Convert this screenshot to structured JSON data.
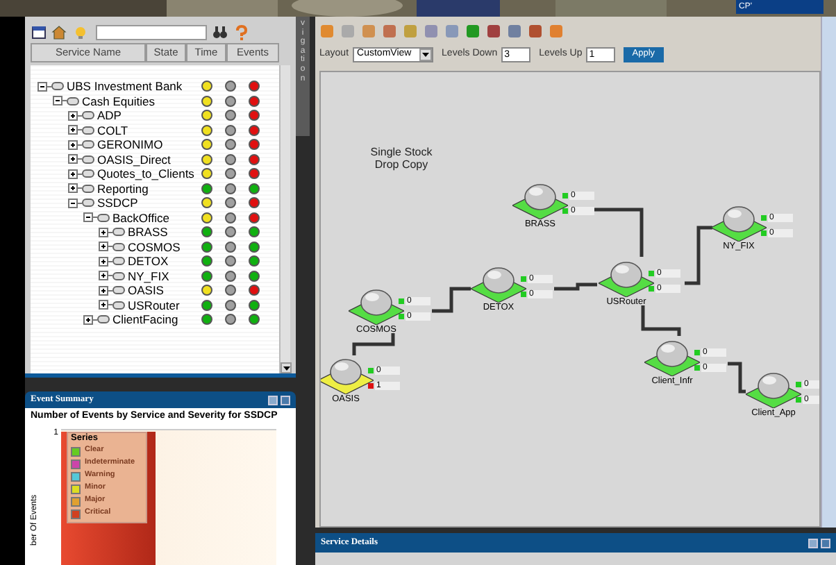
{
  "backdrop": {
    "tab_text": "CP'"
  },
  "service_tree": {
    "columns": [
      "Service Name",
      "State",
      "Time",
      "Events"
    ],
    "nodes": [
      {
        "name": "UBS Investment Bank",
        "expanded": true,
        "indicators": [
          {
            "color": "#f0e020"
          },
          {
            "color": "#a0a0a0"
          },
          {
            "color": "#e01010"
          }
        ],
        "children": [
          {
            "name": "Cash Equities",
            "expanded": true,
            "indicators": [
              {
                "color": "#f0e020"
              },
              {
                "color": "#a0a0a0"
              },
              {
                "color": "#e01010"
              }
            ],
            "children": [
              {
                "name": "ADP",
                "expanded": false,
                "indicators": [
                  {
                    "color": "#f0e020"
                  },
                  {
                    "color": "#a0a0a0"
                  },
                  {
                    "color": "#e01010"
                  }
                ]
              },
              {
                "name": "COLT",
                "expanded": false,
                "indicators": [
                  {
                    "color": "#f0e020"
                  },
                  {
                    "color": "#a0a0a0"
                  },
                  {
                    "color": "#e01010"
                  }
                ]
              },
              {
                "name": "GERONIMO",
                "expanded": false,
                "indicators": [
                  {
                    "color": "#f0e020"
                  },
                  {
                    "color": "#a0a0a0"
                  },
                  {
                    "color": "#e01010"
                  }
                ]
              },
              {
                "name": "OASIS_Direct",
                "expanded": false,
                "indicators": [
                  {
                    "color": "#f0e020"
                  },
                  {
                    "color": "#a0a0a0"
                  },
                  {
                    "color": "#e01010"
                  }
                ]
              },
              {
                "name": "Quotes_to_Clients",
                "expanded": false,
                "indicators": [
                  {
                    "color": "#f0e020"
                  },
                  {
                    "color": "#a0a0a0"
                  },
                  {
                    "color": "#e01010"
                  }
                ]
              },
              {
                "name": "Reporting",
                "expanded": false,
                "indicators": [
                  {
                    "color": "#10b010"
                  },
                  {
                    "color": "#a0a0a0"
                  },
                  {
                    "color": "#10b010"
                  }
                ]
              },
              {
                "name": "SSDCP",
                "expanded": true,
                "indicators": [
                  {
                    "color": "#f0e020"
                  },
                  {
                    "color": "#a0a0a0"
                  },
                  {
                    "color": "#e01010"
                  }
                ],
                "children": [
                  {
                    "name": "BackOffice",
                    "expanded": true,
                    "indicators": [
                      {
                        "color": "#f0e020"
                      },
                      {
                        "color": "#a0a0a0"
                      },
                      {
                        "color": "#e01010"
                      }
                    ],
                    "children": [
                      {
                        "name": "BRASS",
                        "expanded": false,
                        "indicators": [
                          {
                            "color": "#10b010"
                          },
                          {
                            "color": "#a0a0a0"
                          },
                          {
                            "color": "#10b010"
                          }
                        ]
                      },
                      {
                        "name": "COSMOS",
                        "expanded": false,
                        "indicators": [
                          {
                            "color": "#10b010"
                          },
                          {
                            "color": "#a0a0a0"
                          },
                          {
                            "color": "#10b010"
                          }
                        ]
                      },
                      {
                        "name": "DETOX",
                        "expanded": false,
                        "indicators": [
                          {
                            "color": "#10b010"
                          },
                          {
                            "color": "#a0a0a0"
                          },
                          {
                            "color": "#10b010"
                          }
                        ]
                      },
                      {
                        "name": "NY_FIX",
                        "expanded": false,
                        "indicators": [
                          {
                            "color": "#10b010"
                          },
                          {
                            "color": "#a0a0a0"
                          },
                          {
                            "color": "#10b010"
                          }
                        ]
                      },
                      {
                        "name": "OASIS",
                        "expanded": false,
                        "indicators": [
                          {
                            "color": "#f0e020"
                          },
                          {
                            "color": "#a0a0a0"
                          },
                          {
                            "color": "#e01010"
                          }
                        ]
                      },
                      {
                        "name": "USRouter",
                        "expanded": false,
                        "indicators": [
                          {
                            "color": "#10b010"
                          },
                          {
                            "color": "#a0a0a0"
                          },
                          {
                            "color": "#10b010"
                          }
                        ]
                      }
                    ]
                  },
                  {
                    "name": "ClientFacing",
                    "expanded": false,
                    "indicators": [
                      {
                        "color": "#10b010"
                      },
                      {
                        "color": "#a0a0a0"
                      },
                      {
                        "color": "#10b010"
                      }
                    ]
                  }
                ]
              }
            ]
          }
        ]
      }
    ]
  },
  "navigation_tab": {
    "label": "vigation"
  },
  "event_summary": {
    "title": "Event Summary",
    "chart_title": "Number of Events by Service and Severity for SSDCP",
    "tick": "1",
    "ylabel": "ber Of Events",
    "legend_title": "Series",
    "legend": [
      {
        "label": "Clear",
        "color": "#66cc22"
      },
      {
        "label": "Indeterminate",
        "color": "#cc44aa"
      },
      {
        "label": "Warning",
        "color": "#55c8d8"
      },
      {
        "label": "Minor",
        "color": "#dddd22"
      },
      {
        "label": "Major",
        "color": "#e0a030"
      },
      {
        "label": "Critical",
        "color": "#d04020"
      }
    ]
  },
  "view": {
    "layout_label": "Layout",
    "layout_value": "CustomView",
    "levels_down_label": "Levels Down",
    "levels_down": "3",
    "levels_up_label": "Levels Up",
    "levels_up": "1",
    "apply": "Apply",
    "caption": "Single Stock Drop Copy",
    "nodes": [
      {
        "name": "BRASS",
        "color": "#55dd44",
        "counters": [
          {
            "value": "0",
            "color": "#22cc22"
          },
          {
            "value": "0",
            "color": "#22cc22"
          }
        ]
      },
      {
        "name": "NY_FIX",
        "color": "#55dd44",
        "counters": [
          {
            "value": "0",
            "color": "#22cc22"
          },
          {
            "value": "0",
            "color": "#22cc22"
          }
        ]
      },
      {
        "name": "DETOX",
        "color": "#55dd44",
        "counters": [
          {
            "value": "0",
            "color": "#22cc22"
          },
          {
            "value": "0",
            "color": "#22cc22"
          }
        ]
      },
      {
        "name": "USRouter",
        "color": "#55dd44",
        "counters": [
          {
            "value": "0",
            "color": "#22cc22"
          },
          {
            "value": "0",
            "color": "#22cc22"
          }
        ]
      },
      {
        "name": "COSMOS",
        "color": "#55dd44",
        "counters": [
          {
            "value": "0",
            "color": "#22cc22"
          },
          {
            "value": "0",
            "color": "#22cc22"
          }
        ]
      },
      {
        "name": "OASIS",
        "color": "#eeee44",
        "counters": [
          {
            "value": "0",
            "color": "#22cc22"
          },
          {
            "value": "1",
            "color": "#dd1111"
          }
        ]
      },
      {
        "name": "Client_Infr",
        "color": "#55dd44",
        "counters": [
          {
            "value": "0",
            "color": "#22cc22"
          },
          {
            "value": "0",
            "color": "#22cc22"
          }
        ]
      },
      {
        "name": "Client_App",
        "color": "#55dd44",
        "counters": [
          {
            "value": "0",
            "color": "#22cc22"
          },
          {
            "value": "0",
            "color": "#22cc22"
          }
        ]
      }
    ]
  },
  "service_details": {
    "title": "Service Details"
  }
}
